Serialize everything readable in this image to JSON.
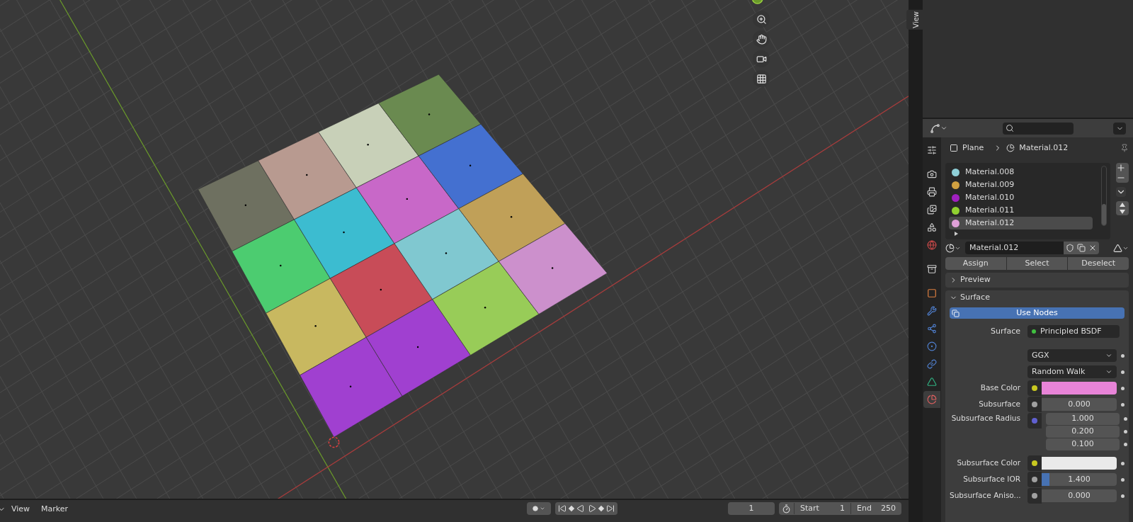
{
  "viewport": {
    "sidebar_tab": "View"
  },
  "timeline": {
    "menus": [
      "View",
      "Marker"
    ],
    "current_frame": "1",
    "start_label": "Start",
    "start": "1",
    "end_label": "End",
    "end": "250"
  },
  "properties": {
    "breadcrumb": [
      "Plane",
      "Material.012"
    ],
    "tab_groups": [
      [
        {
          "kind": "tool",
          "selected": false
        }
      ],
      [
        {
          "kind": "render",
          "selected": false
        },
        {
          "kind": "output",
          "selected": false
        },
        {
          "kind": "view_layer",
          "selected": false
        },
        {
          "kind": "scene",
          "selected": false
        },
        {
          "kind": "world",
          "selected": false
        }
      ],
      [
        {
          "kind": "collection",
          "selected": false
        }
      ],
      [
        {
          "kind": "object",
          "selected": false
        },
        {
          "kind": "modifier",
          "selected": false
        },
        {
          "kind": "particles",
          "selected": false
        },
        {
          "kind": "physics",
          "selected": false
        },
        {
          "kind": "constraints",
          "selected": false
        },
        {
          "kind": "data",
          "selected": false
        },
        {
          "kind": "material",
          "selected": true
        }
      ]
    ],
    "material_slots": [
      {
        "name": "Material.008",
        "color": "#8fd0d8",
        "selected": false
      },
      {
        "name": "Material.009",
        "color": "#d0a040",
        "selected": false
      },
      {
        "name": "Material.010",
        "color": "#a020c0",
        "selected": false
      },
      {
        "name": "Material.011",
        "color": "#90d030",
        "selected": false
      },
      {
        "name": "Material.012",
        "color": "#e0a0d8",
        "selected": true
      }
    ],
    "material_name": "Material.012",
    "buttons": [
      "Assign",
      "Select",
      "Deselect"
    ],
    "panels": [
      {
        "title": "Preview",
        "expanded": false
      },
      {
        "title": "Surface",
        "expanded": true
      }
    ],
    "use_nodes": "Use Nodes",
    "surface": {
      "label": "Surface",
      "value": "Principled BSDF"
    },
    "rows": [
      {
        "kind": "dropdown",
        "value": "GGX"
      },
      {
        "kind": "dropdown",
        "value": "Random Walk"
      },
      {
        "kind": "color",
        "label": "Base Color",
        "color": "#c8c820",
        "swatch": {
          "color": "#e884d8"
        }
      },
      {
        "kind": "number",
        "label": "Subsurface",
        "color": "#a0a0a0",
        "value": "0.000",
        "level": 0
      },
      {
        "kind": "vector",
        "label": "Subsurface Radius",
        "color": "#6060d0",
        "values": [
          "1.000",
          "0.200",
          "0.100"
        ]
      },
      {
        "kind": "color",
        "label": "Subsurface Color",
        "color": "#c8c820",
        "swatch": {
          "color": "#eaeaea"
        }
      },
      {
        "kind": "number",
        "label": "Subsurface IOR",
        "color": "#a0a0a0",
        "value": "1.400",
        "level": 0.1
      },
      {
        "kind": "number",
        "label": "Subsurface Aniso...",
        "color": "#a0a0a0",
        "value": "0.000",
        "level": 0
      }
    ]
  }
}
